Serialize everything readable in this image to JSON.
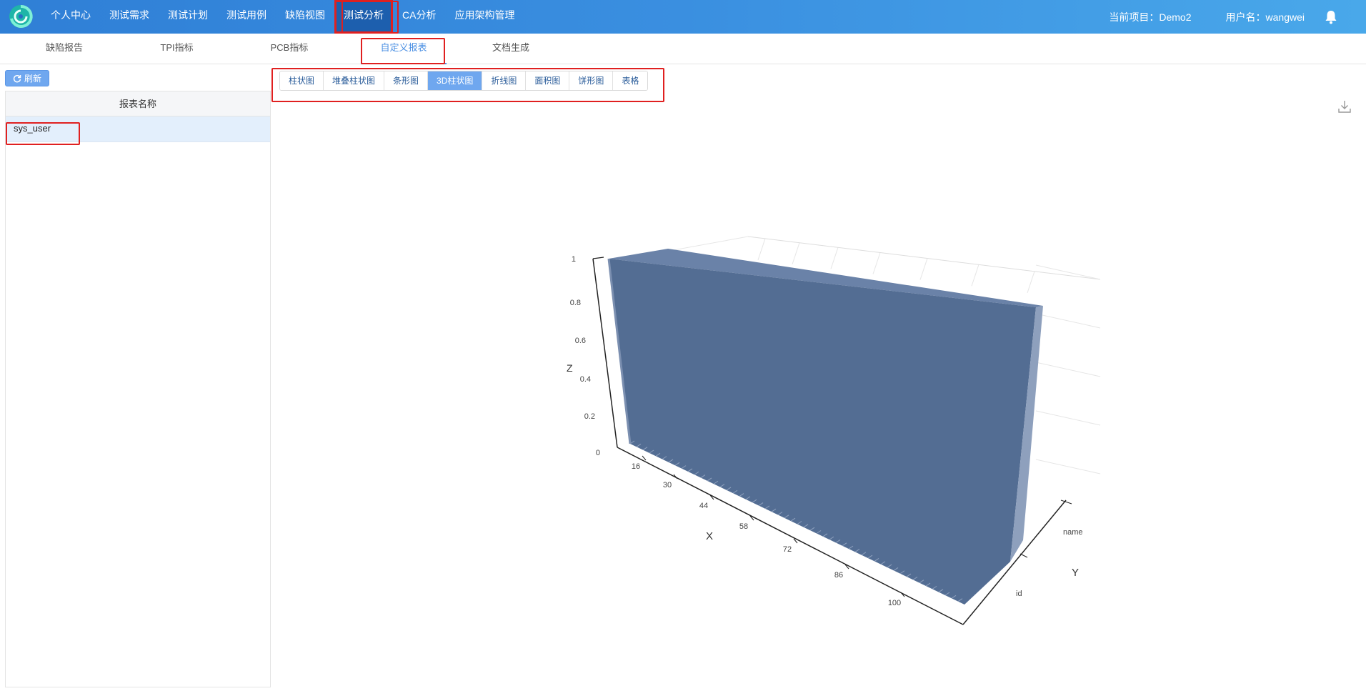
{
  "nav": {
    "items": [
      "个人中心",
      "测试需求",
      "测试计划",
      "测试用例",
      "缺陷视图",
      "测试分析",
      "CA分析",
      "应用架构管理"
    ],
    "active_index": 5,
    "project_label": "当前项目：Demo2",
    "user_label": "用户名：wangwei"
  },
  "subtabs": {
    "items": [
      "缺陷报告",
      "TPI指标",
      "PCB指标",
      "自定义报表",
      "文档生成"
    ],
    "active_index": 3
  },
  "left": {
    "refresh_label": "刷新",
    "column_header": "报表名称",
    "rows": [
      "sys_user"
    ]
  },
  "chart_tabs": {
    "items": [
      "柱状图",
      "堆叠柱状图",
      "条形图",
      "3D柱状图",
      "折线图",
      "面积图",
      "饼形图",
      "表格"
    ],
    "active_index": 3
  },
  "colors": {
    "nav_start": "#2f7fd6",
    "nav_end": "#49a8ea",
    "accent": "#4a8fe3",
    "bar_color": "#536d93",
    "highlight_box": "#e02020"
  },
  "icons": [
    "app-logo-icon",
    "bell-icon",
    "refresh-icon",
    "download-icon"
  ],
  "chart_data": {
    "type": "bar3d",
    "xlabel": "X",
    "ylabel": "Y",
    "zlabel": "Z",
    "x_ticks": [
      "16",
      "30",
      "44",
      "58",
      "72",
      "86",
      "100"
    ],
    "y_categories": [
      "id",
      "name"
    ],
    "z_ticks": [
      "0",
      "0.2",
      "0.4",
      "0.6",
      "0.8",
      "1"
    ],
    "x_range": [
      1,
      106
    ],
    "z_range": [
      0,
      1
    ],
    "series": [
      {
        "values_note_free": true,
        "x_start": 1,
        "x_end": 106,
        "z": 1
      }
    ]
  }
}
